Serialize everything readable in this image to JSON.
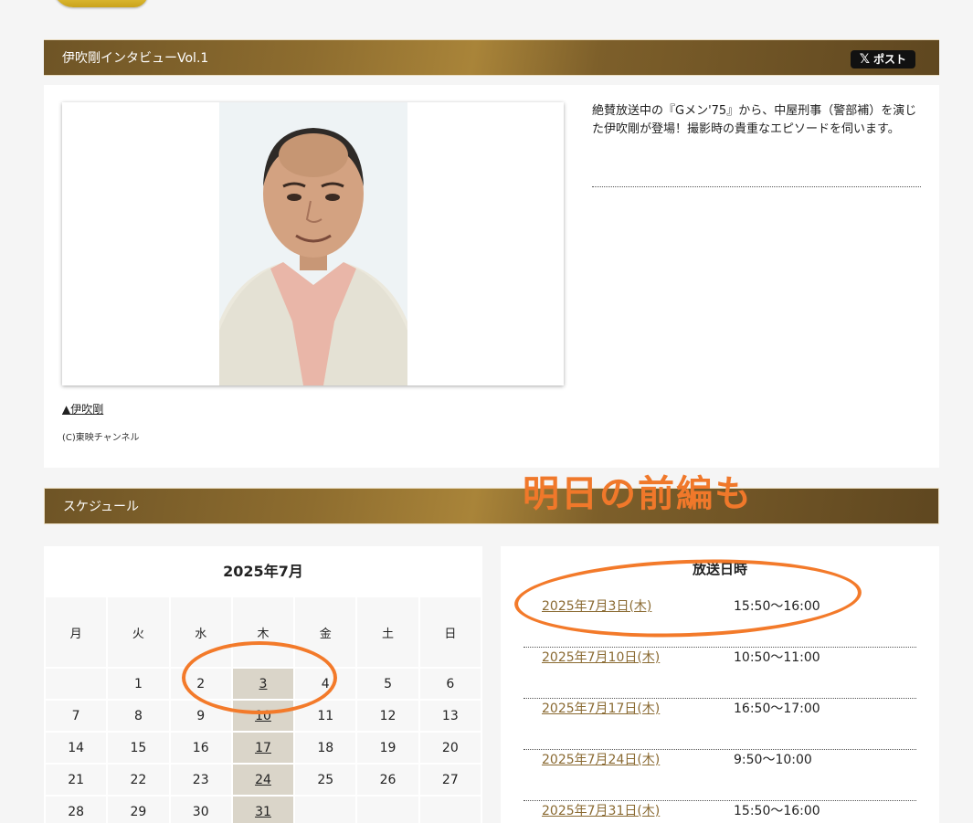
{
  "article": {
    "section_title": "伊吹剛インタビューVol.1",
    "share_label": "ポスト",
    "share_icon": "x-logo-icon",
    "lead": "絶賛放送中の『Gメン'75』から、中屋刑事（警部補）を演じた伊吹剛が登場！撮影時の貴重なエピソードを伺います。",
    "photo_caption": "▲伊吹剛",
    "copyright": "(C)東映チャンネル"
  },
  "overlay_text": "明日の前編も",
  "schedule_section_title": "スケジュール",
  "calendar": {
    "title": "2025年7月",
    "weekdays": [
      "月",
      "火",
      "水",
      "木",
      "金",
      "土",
      "日"
    ],
    "weeks": [
      [
        "",
        "1",
        "2",
        "3",
        "4",
        "5",
        "6"
      ],
      [
        "7",
        "8",
        "9",
        "10",
        "11",
        "12",
        "13"
      ],
      [
        "14",
        "15",
        "16",
        "17",
        "18",
        "19",
        "20"
      ],
      [
        "21",
        "22",
        "23",
        "24",
        "25",
        "26",
        "27"
      ],
      [
        "28",
        "29",
        "30",
        "31",
        "",
        "",
        ""
      ]
    ],
    "broadcast_days": [
      "3",
      "10",
      "17",
      "24",
      "31"
    ]
  },
  "broadcast": {
    "title": "放送日時",
    "rows": [
      {
        "date": "2025年7月3日(木)",
        "time": "15:50〜16:00"
      },
      {
        "date": "2025年7月10日(木)",
        "time": "10:50〜11:00"
      },
      {
        "date": "2025年7月17日(木)",
        "time": "16:50〜17:00"
      },
      {
        "date": "2025年7月24日(木)",
        "time": "9:50〜10:00"
      },
      {
        "date": "2025年7月31日(木)",
        "time": "15:50〜16:00"
      }
    ]
  },
  "colors": {
    "header_bar": "#8e6d2f",
    "annotation": "#f37a2a",
    "broadcast_day_cell": "#dad5c9",
    "link": "#8a6a32"
  }
}
